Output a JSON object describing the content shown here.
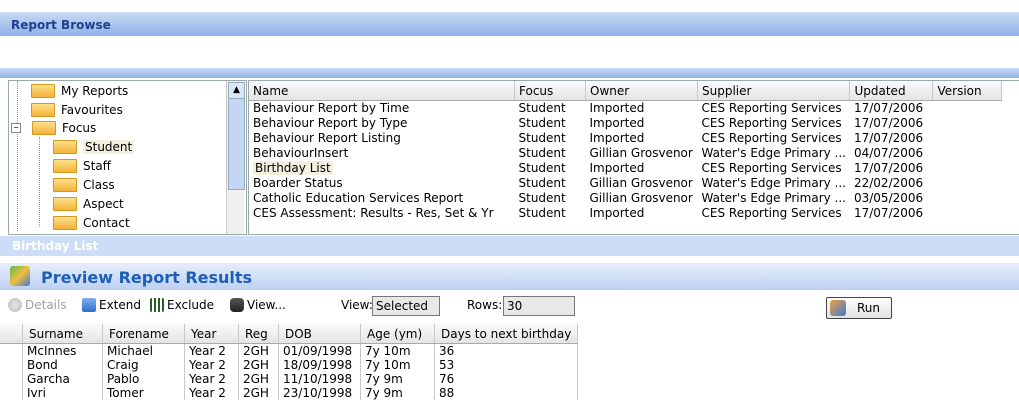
{
  "window": {
    "title": "Report Browse"
  },
  "tree": {
    "items": [
      {
        "label": "My Reports"
      },
      {
        "label": "Favourites"
      },
      {
        "label": "Focus",
        "expander": "−"
      },
      {
        "label": "Student"
      },
      {
        "label": "Staff"
      },
      {
        "label": "Class"
      },
      {
        "label": "Aspect"
      },
      {
        "label": "Contact"
      }
    ],
    "scroll_up": "▲"
  },
  "reports": {
    "columns": [
      "Name",
      "Focus",
      "Owner",
      "Supplier",
      "Updated",
      "Version"
    ],
    "rows": [
      [
        "Behaviour Report by Time",
        "Student",
        "Imported",
        "CES Reporting Services",
        "17/07/2006",
        ""
      ],
      [
        "Behaviour Report by Type",
        "Student",
        "Imported",
        "CES Reporting Services",
        "17/07/2006",
        ""
      ],
      [
        "Behaviour Report Listing",
        "Student",
        "Imported",
        "CES Reporting Services",
        "17/07/2006",
        ""
      ],
      [
        "BehaviourInsert",
        "Student",
        "Gillian Grosvenor",
        "Water's Edge Primary ...",
        "04/07/2006",
        ""
      ],
      [
        "Birthday List",
        "Student",
        "Imported",
        "CES Reporting Services",
        "17/07/2006",
        ""
      ],
      [
        "Boarder Status",
        "Student",
        "Gillian Grosvenor",
        "Water's Edge Primary ...",
        "22/02/2006",
        ""
      ],
      [
        "Catholic Education Services Report",
        "Student",
        "Gillian Grosvenor",
        "Water's Edge Primary ...",
        "03/05/2006",
        ""
      ],
      [
        "CES Assessment: Results - Res, Set & Yr",
        "Student",
        "Imported",
        "CES Reporting Services",
        "17/07/2006",
        ""
      ]
    ]
  },
  "selected_report": {
    "caption": "Birthday List"
  },
  "preview": {
    "title": "Preview Report Results",
    "toolbar": {
      "details": "Details",
      "extend": "Extend",
      "exclude": "Exclude",
      "view_menu": "View...",
      "view_label": "View:",
      "view_value": "Selected",
      "rows_label": "Rows:",
      "rows_value": "30",
      "run": "Run"
    }
  },
  "results": {
    "columns": [
      "Surname",
      "Forename",
      "Year",
      "Reg",
      "DOB",
      "Age (ym)",
      "Days to next birthday"
    ],
    "rows": [
      [
        "McInnes",
        "Michael",
        "Year 2",
        "2GH",
        "01/09/1998",
        "7y 10m",
        "36"
      ],
      [
        "Bond",
        "Craig",
        "Year 2",
        "2GH",
        "18/09/1998",
        "7y 10m",
        "53"
      ],
      [
        "Garcha",
        "Pablo",
        "Year 2",
        "2GH",
        "11/10/1998",
        "7y 9m",
        "76"
      ],
      [
        "Ivri",
        "Tomer",
        "Year 2",
        "2GH",
        "23/10/1998",
        "7y 9m",
        "88"
      ]
    ]
  }
}
